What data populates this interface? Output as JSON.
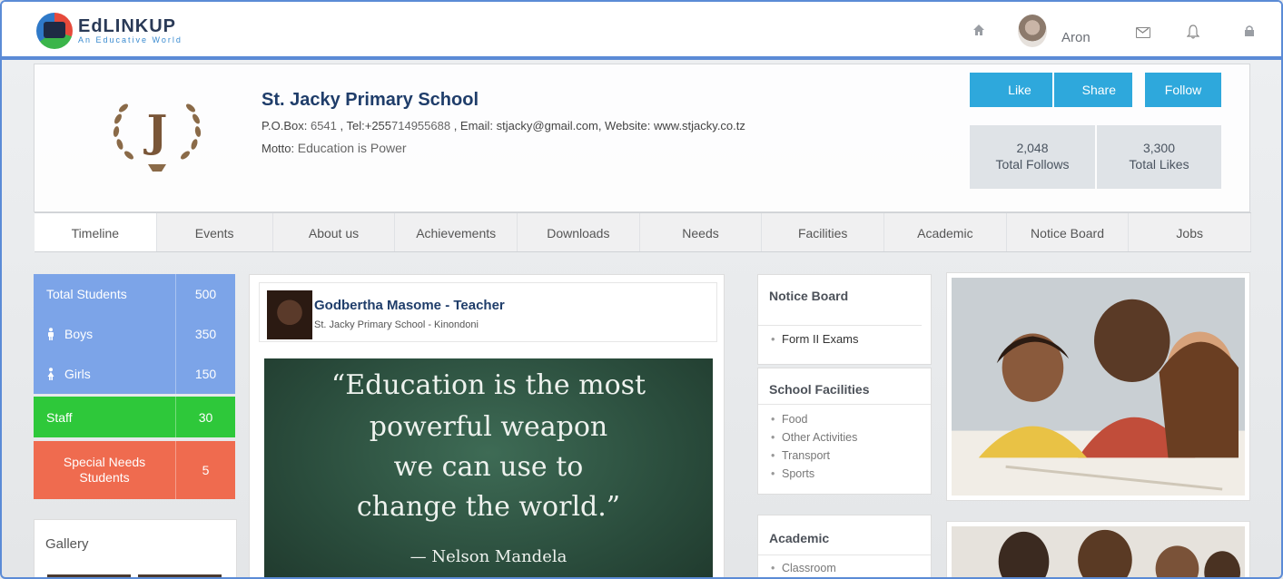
{
  "brand": {
    "name": "EdLINKUP",
    "tagline": "An Educative World"
  },
  "user": {
    "name": "Aron"
  },
  "school": {
    "name": "St. Jacky Primary School",
    "crest_letter": "J",
    "info_prefix_pobox": "P.O.Box: ",
    "pobox": "6541",
    "info_tel_label": " , Tel:+255",
    "tel": "714955688",
    "info_rest": " , Email: stjacky@gmail.com, Website: www.stjacky.co.tz",
    "motto_label": "Motto: ",
    "motto": "Education is Power"
  },
  "actions": {
    "like": "Like",
    "share": "Share",
    "follow": "Follow"
  },
  "stats": {
    "follows_value": "2,048",
    "follows_label": "Total Follows",
    "likes_value": "3,300",
    "likes_label": "Total Likes"
  },
  "nav": [
    "Timeline",
    "Events",
    "About us",
    "Achievements",
    "Downloads",
    "Needs",
    "Facilities",
    "Academic",
    "Notice Board",
    "Jobs"
  ],
  "students": {
    "total_label": "Total Students",
    "total": "500",
    "boys_label": "Boys",
    "boys": "350",
    "girls_label": "Girls",
    "girls": "150",
    "staff_label": "Staff",
    "staff": "30",
    "special_label_1": "Special Needs",
    "special_label_2": "Students",
    "special": "5"
  },
  "colors": {
    "blue_panel": "#7ca4e8",
    "staff_green": "#2ec83a",
    "special_red": "#ef6b4f",
    "accent": "#2ea8dc"
  },
  "gallery": {
    "title": "Gallery"
  },
  "post": {
    "author": "Godbertha Masome - Teacher",
    "subtitle": "St. Jacky Primary School - Kinondoni",
    "quote_lines": [
      "“Education is the most",
      "powerful weapon",
      "we can use to",
      "change the world.”"
    ],
    "quote_author": "— Nelson Mandela"
  },
  "notice_board": {
    "title": "Notice Board",
    "items": [
      "Form II Exams"
    ]
  },
  "facilities": {
    "title": "School Facilities",
    "items": [
      "Food",
      "Other Activities",
      "Transport",
      "Sports"
    ]
  },
  "academic": {
    "title": "Academic",
    "items": [
      "Classroom"
    ]
  }
}
